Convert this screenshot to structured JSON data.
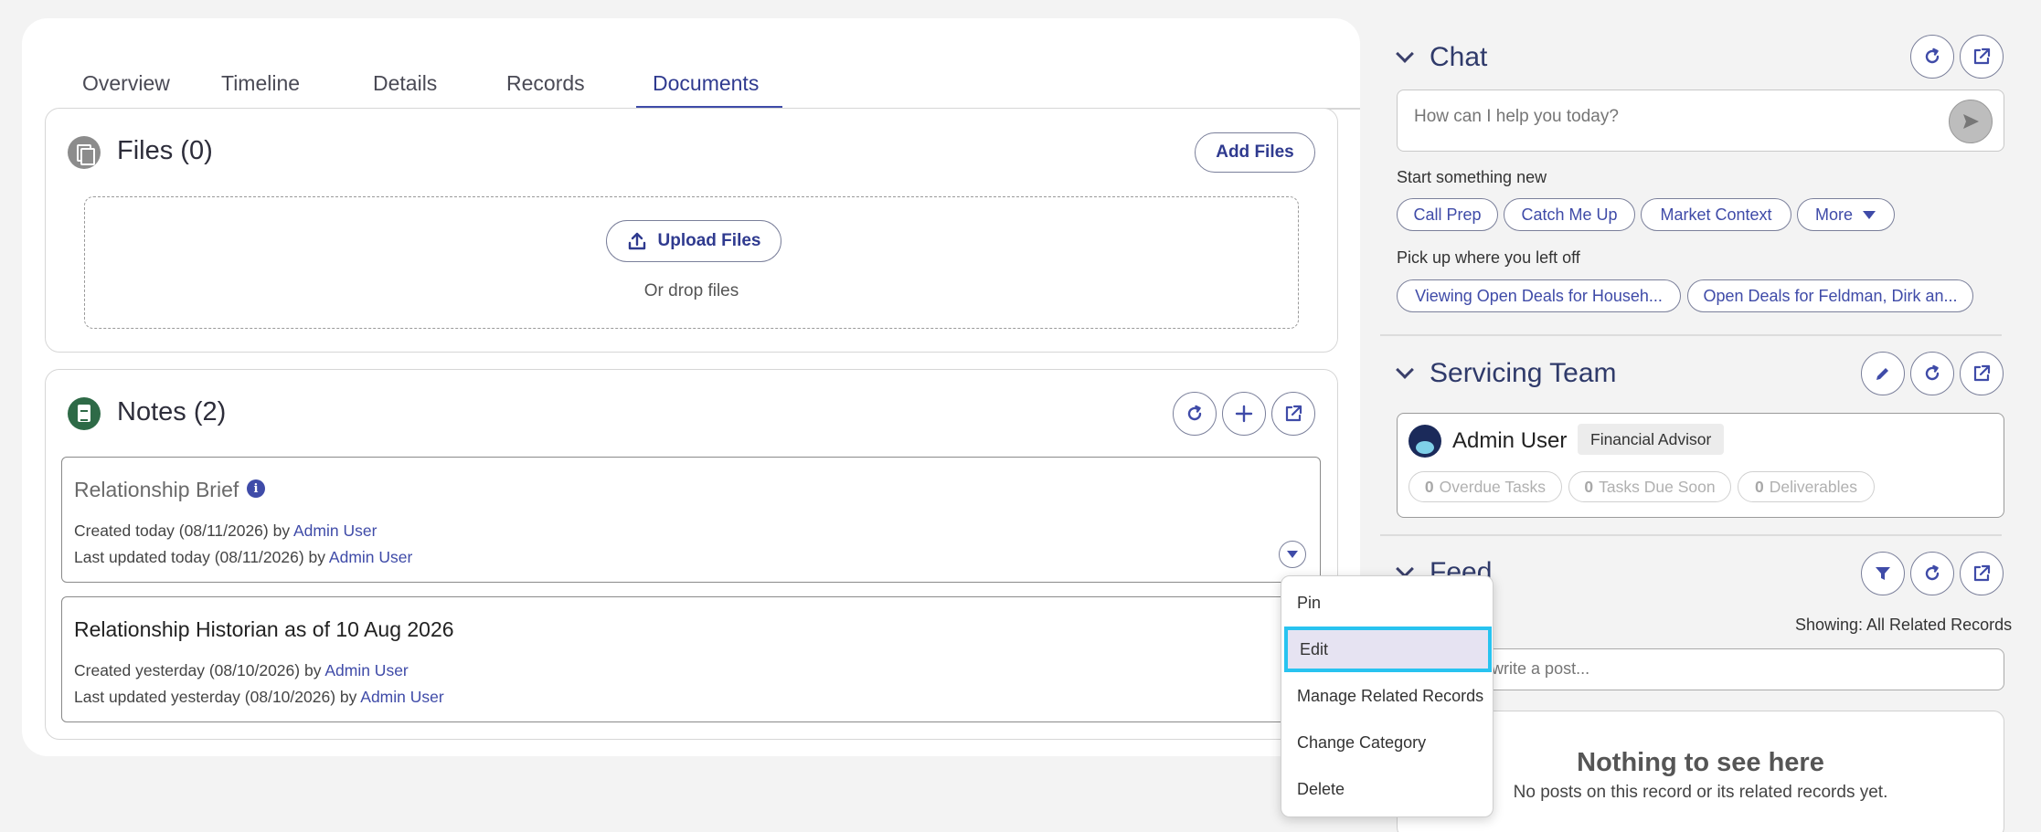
{
  "tabs": [
    "Overview",
    "Timeline",
    "Details",
    "Records",
    "Documents"
  ],
  "active_tab": "Documents",
  "files": {
    "title": "Files (0)",
    "add_label": "Add Files",
    "upload_label": "Upload Files",
    "drop_text": "Or drop files"
  },
  "notes": {
    "title": "Notes (2)",
    "items": [
      {
        "title": "Relationship Brief",
        "created_prefix": "Created today (08/11/2026) by ",
        "created_user": "Admin User",
        "updated_prefix": "Last updated today (08/11/2026) by ",
        "updated_user": "Admin User"
      },
      {
        "title": "Relationship Historian as of 10 Aug 2026",
        "created_prefix": "Created yesterday (08/10/2026) by ",
        "created_user": "Admin User",
        "updated_prefix": "Last updated yesterday (08/10/2026) by ",
        "updated_user": "Admin User"
      }
    ]
  },
  "chat": {
    "title": "Chat",
    "placeholder": "How can I help you today?",
    "start_label": "Start something new",
    "suggestions": [
      "Call Prep",
      "Catch Me Up",
      "Market Context",
      "More"
    ],
    "resume_label": "Pick up where you left off",
    "recent": [
      "Viewing Open Deals for Househ...",
      "Open Deals for Feldman, Dirk an..."
    ]
  },
  "team": {
    "title": "Servicing Team",
    "member_name": "Admin User",
    "member_role": "Financial Advisor",
    "stats": [
      {
        "count": "0",
        "label": "Overdue Tasks"
      },
      {
        "count": "0",
        "label": "Tasks Due Soon"
      },
      {
        "count": "0",
        "label": "Deliverables"
      }
    ]
  },
  "feed": {
    "title": "Feed",
    "showing": "Showing: All Related Records",
    "search_placeholder": "Search or write a post...",
    "empty_title": "Nothing to see here",
    "empty_sub": "No posts on this record or its related records yet."
  },
  "menu": {
    "items": [
      "Pin",
      "Edit",
      "Manage Related Records",
      "Change Category",
      "Delete"
    ],
    "selected": "Edit"
  },
  "colors": {
    "accent": "#3f4ba8",
    "selection_outline": "#28c3f0",
    "notes_icon": "#2e6a47"
  }
}
